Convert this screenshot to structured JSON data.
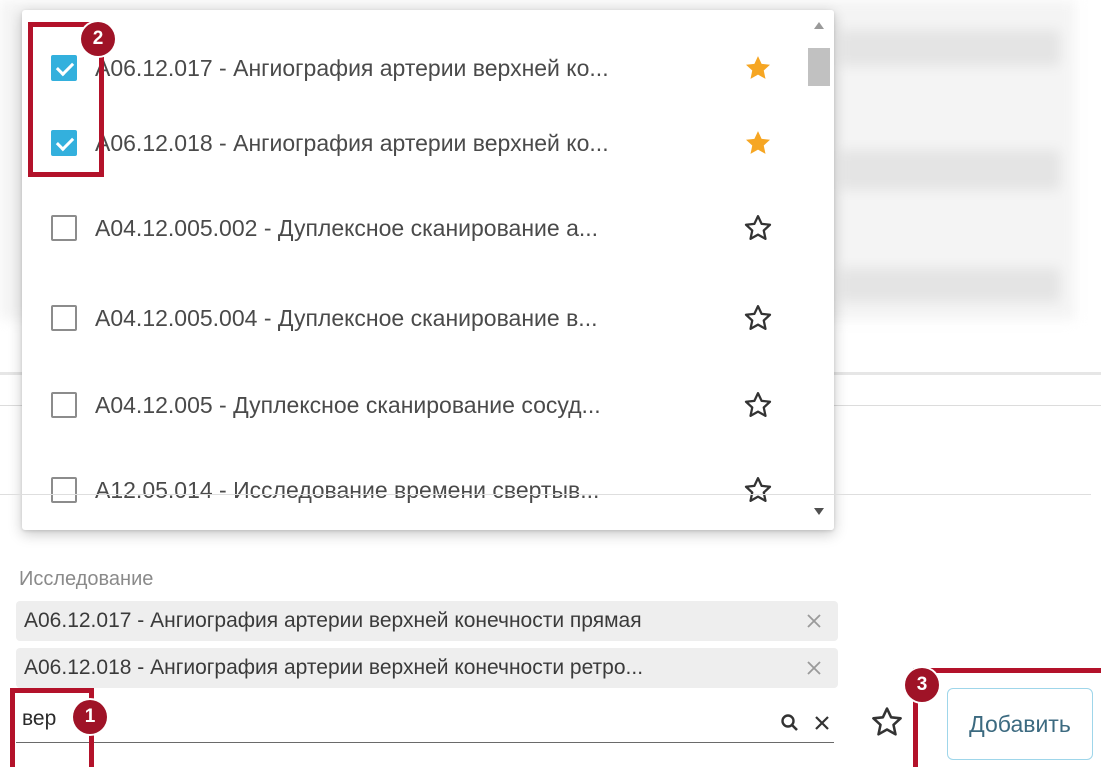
{
  "dropdown": {
    "options": [
      {
        "label": "A06.12.017 - Ангиография артерии верхней ко...",
        "checked": true,
        "favorite": true
      },
      {
        "label": "A06.12.018 - Ангиография артерии верхней ко...",
        "checked": true,
        "favorite": true
      },
      {
        "label": "A04.12.005.002 - Дуплексное сканирование а...",
        "checked": false,
        "favorite": false
      },
      {
        "label": "A04.12.005.004 - Дуплексное сканирование в...",
        "checked": false,
        "favorite": false
      },
      {
        "label": "A04.12.005 - Дуплексное сканирование сосуд...",
        "checked": false,
        "favorite": false
      },
      {
        "label": "A12.05.014 - Исследование времени свертыв...",
        "checked": false,
        "favorite": false
      }
    ]
  },
  "form": {
    "field_label": "Исследование",
    "selected": [
      "A06.12.017 - Ангиография артерии верхней конечности прямая",
      "A06.12.018 - Ангиография артерии верхней конечности ретро..."
    ],
    "search_value": "вер",
    "add_button": "Добавить"
  },
  "annotations": {
    "badge_1": "1",
    "badge_2": "2",
    "badge_3": "3"
  },
  "colors": {
    "accent": "#33b0dd",
    "star_filled": "#f6a623",
    "annotation": "#b3122a"
  }
}
